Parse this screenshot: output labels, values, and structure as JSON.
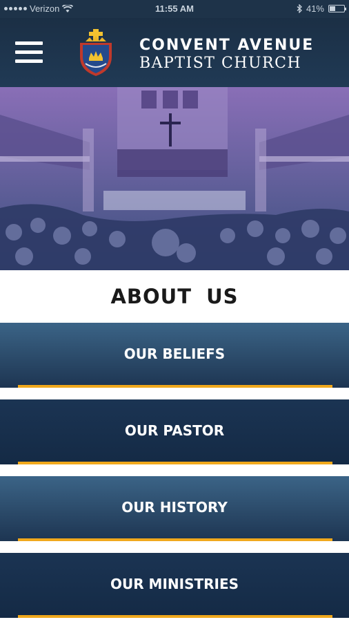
{
  "status_bar": {
    "carrier": "Verizon",
    "time": "11:55 AM",
    "battery_percent": "41%",
    "battery_level": 0.41,
    "icons": [
      "signal-dots",
      "wifi-icon",
      "bluetooth-icon",
      "battery-icon"
    ]
  },
  "header": {
    "menu_icon": "hamburger-menu-icon",
    "logo": "church-crest-logo",
    "church_name_line1": "CONVENT AVENUE",
    "church_name_line2": "BAPTIST CHURCH"
  },
  "hero": {
    "image": "church-sanctuary-photo",
    "tint": "#6c5fa6"
  },
  "page": {
    "title": "ABOUT US"
  },
  "menu": {
    "items": [
      {
        "label": "OUR BELIEFS"
      },
      {
        "label": "OUR PASTOR"
      },
      {
        "label": "OUR HISTORY"
      },
      {
        "label": "OUR MINISTRIES"
      }
    ]
  },
  "colors": {
    "header_bg": "#1e3349",
    "button_light": "#3b6487",
    "button_dark": "#142a45",
    "accent_gold": "#f0a81c"
  }
}
